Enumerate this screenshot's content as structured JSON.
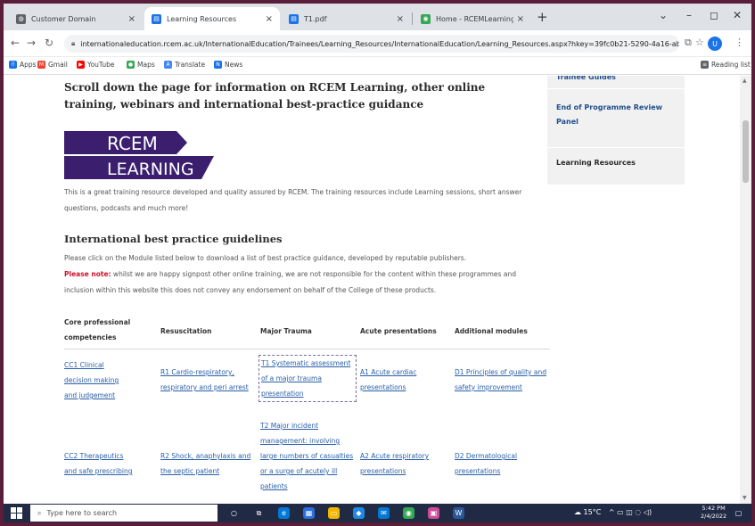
{
  "tabs": [
    {
      "title": "Customer Domain",
      "color": "#5f6368",
      "active": false
    },
    {
      "title": "Learning Resources",
      "color": "#1a73e8",
      "active": true
    },
    {
      "title": "T1.pdf",
      "color": "#1a73e8",
      "active": false
    },
    {
      "title": "Home - RCEMLearning India",
      "color": "#34a853",
      "active": false
    }
  ],
  "address_bar": {
    "url": "internationaleducation.rcem.ac.uk/InternationalEducation/Trainees/Learning_Resources/InternationalEducation/Learning_Resources.aspx?hkey=39fc0b21-5290-4a16-ab54-4c..."
  },
  "bookmarks": {
    "items": [
      {
        "label": "Apps",
        "color": "#1a73e8"
      },
      {
        "label": "Gmail",
        "color": "#ea4335"
      },
      {
        "label": "YouTube",
        "color": "#ff0000"
      },
      {
        "label": "Maps",
        "color": "#34a853"
      },
      {
        "label": "Translate",
        "color": "#4285f4"
      },
      {
        "label": "News",
        "color": "#1a73e8"
      }
    ],
    "reading_list": "Reading list"
  },
  "page": {
    "intro": "Scroll down the page for information on RCEM Learning, other online training, webinars and international best-practice guidance",
    "logo": {
      "line1": "RCEM",
      "line2": "LEARNING"
    },
    "logo_color": "#3b1f6e",
    "description": "This is a great training resource developed and quality assured by RCEM. The training resources include Learning sessions, short answer questions, podcasts and much more!",
    "guidelines_heading": "International best practice guidelines",
    "guidelines_text": "Please click on the Module listed below to download a list of best practice guidance, developed by reputable publishers.",
    "note_label": "Please note:",
    "note_text": " whilst we are happy signpost other online training, we are not responsible for the content within these programmes and inclusion within this website this does not convey any endorsement on behalf of the College of these products."
  },
  "table": {
    "headers": [
      "Core professional competencies",
      "Resuscitation",
      "Major Trauma",
      "Acute presentations",
      "Additional modules"
    ],
    "row1": [
      "CC1 Clinical decision making and judgement",
      "R1 Cardio-respiratory, respiratory and peri arrest",
      "T1 Systematic assessment of a major trauma presentation",
      "A1 Acute cardiac presentations",
      "D1 Principles of quality and safety improvement"
    ],
    "t2": "T2 Major incident management: involving large numbers of casualties or a surge of acutely ill patients",
    "row2": [
      "CC2 Therapeutics and safe prescribing",
      "R2 Shock, anaphylaxis and the septic patient",
      "A2 Acute respiratory presentations",
      "D2 Dermatological presentations"
    ]
  },
  "sidebar": {
    "partial": "Trainee Guides",
    "end_review": "End of Programme Review Panel",
    "learning": "Learning Resources"
  },
  "taskbar": {
    "search_placeholder": "Type here to search",
    "weather": "15°C",
    "time": "5:42 PM",
    "date": "2/4/2022"
  }
}
